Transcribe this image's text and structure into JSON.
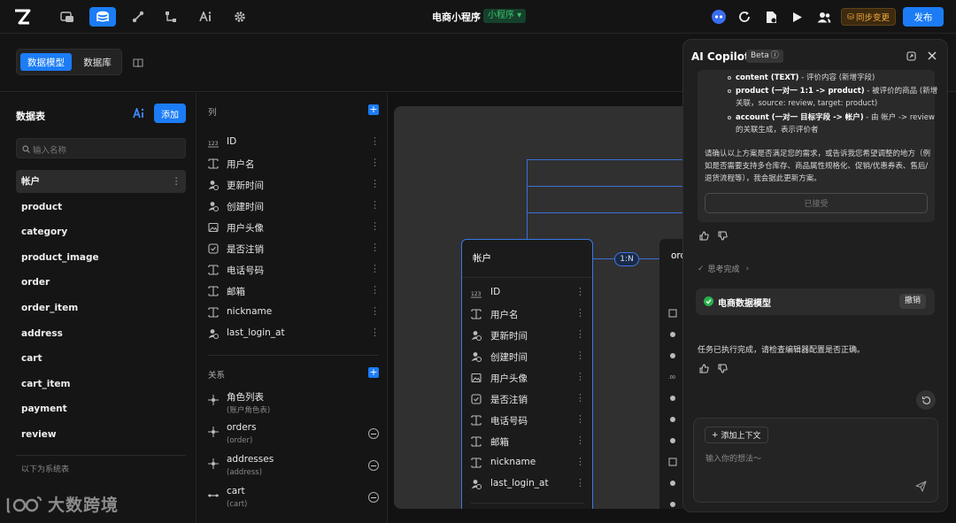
{
  "topbar": {
    "app_title": "电商小程序",
    "app_badge": "小程序",
    "sync_label": "同步变更",
    "publish_label": "发布"
  },
  "subheader": {
    "tab_model": "数据模型",
    "tab_db": "数据库"
  },
  "tables": {
    "title": "数据表",
    "add_label": "添加",
    "search_placeholder": "输入名称",
    "items": [
      "帐户",
      "product",
      "category",
      "product_image",
      "order",
      "order_item",
      "address",
      "cart",
      "cart_item",
      "payment",
      "review"
    ],
    "footer": "以下为系统表"
  },
  "columns": {
    "section_label": "列",
    "items": [
      {
        "name": "ID",
        "icon": "number-icon"
      },
      {
        "name": "用户名",
        "icon": "text-icon"
      },
      {
        "name": "更新时间",
        "icon": "user-time-icon"
      },
      {
        "name": "创建时间",
        "icon": "user-time-icon"
      },
      {
        "name": "用户头像",
        "icon": "image-icon"
      },
      {
        "name": "是否注销",
        "icon": "checkbox-icon"
      },
      {
        "name": "电话号码",
        "icon": "text-icon"
      },
      {
        "name": "邮箱",
        "icon": "text-icon"
      },
      {
        "name": "nickname",
        "icon": "text-icon"
      },
      {
        "name": "last_login_at",
        "icon": "user-time-icon"
      }
    ]
  },
  "relations": {
    "section_label": "关系",
    "items": [
      {
        "name": "角色列表",
        "sub": "(账户角色表)"
      },
      {
        "name": "orders",
        "sub": "(order)"
      },
      {
        "name": "addresses",
        "sub": "(address)"
      },
      {
        "name": "cart",
        "sub": "(cart)"
      }
    ]
  },
  "canvas": {
    "entity_title": "帐户",
    "relation_label": "1:N",
    "entity2_title": "ord",
    "rows": [
      "ID",
      "用户名",
      "更新时间",
      "创建时间",
      "用户头像",
      "是否注销",
      "电话号码",
      "邮箱",
      "nickname",
      "last_login_at"
    ]
  },
  "copilot": {
    "title": "AI Copilot",
    "beta": "Beta",
    "bullet1_strong": "content (TEXT)",
    "bullet1_rest": " - 评价内容 (新增字段)",
    "bullet2_strong": "product (一对一 1:1 -> product)",
    "bullet2_rest": " - 被评价的商品 (新增关联，source: review, target: product)",
    "bullet3_strong": "account (一对一 目标字段 -> 帐户)",
    "bullet3_rest": " - 由 帐户 -> review 的关联生成，表示评价者",
    "confirm_text": "请确认以上方案是否满足您的需求，或告诉我您希望调整的地方（例如是否需要支持多仓库存、商品属性规格化、促销/优惠券表、售后/退货流程等），我会据此更新方案。",
    "accepted_label": "已接受",
    "thinking_label": "思考完成",
    "card_title": "电商数据模型",
    "undo_label": "撤销",
    "done_text": "任务已执行完成，请检查编辑器配置是否正确。",
    "context_label": "添加上下文",
    "input_placeholder": "输入你的想法～"
  },
  "watermark": {
    "text": "大数跨境"
  },
  "colors": {
    "accent": "#1b7cf5",
    "background": "#121212",
    "success": "#28b24b"
  }
}
